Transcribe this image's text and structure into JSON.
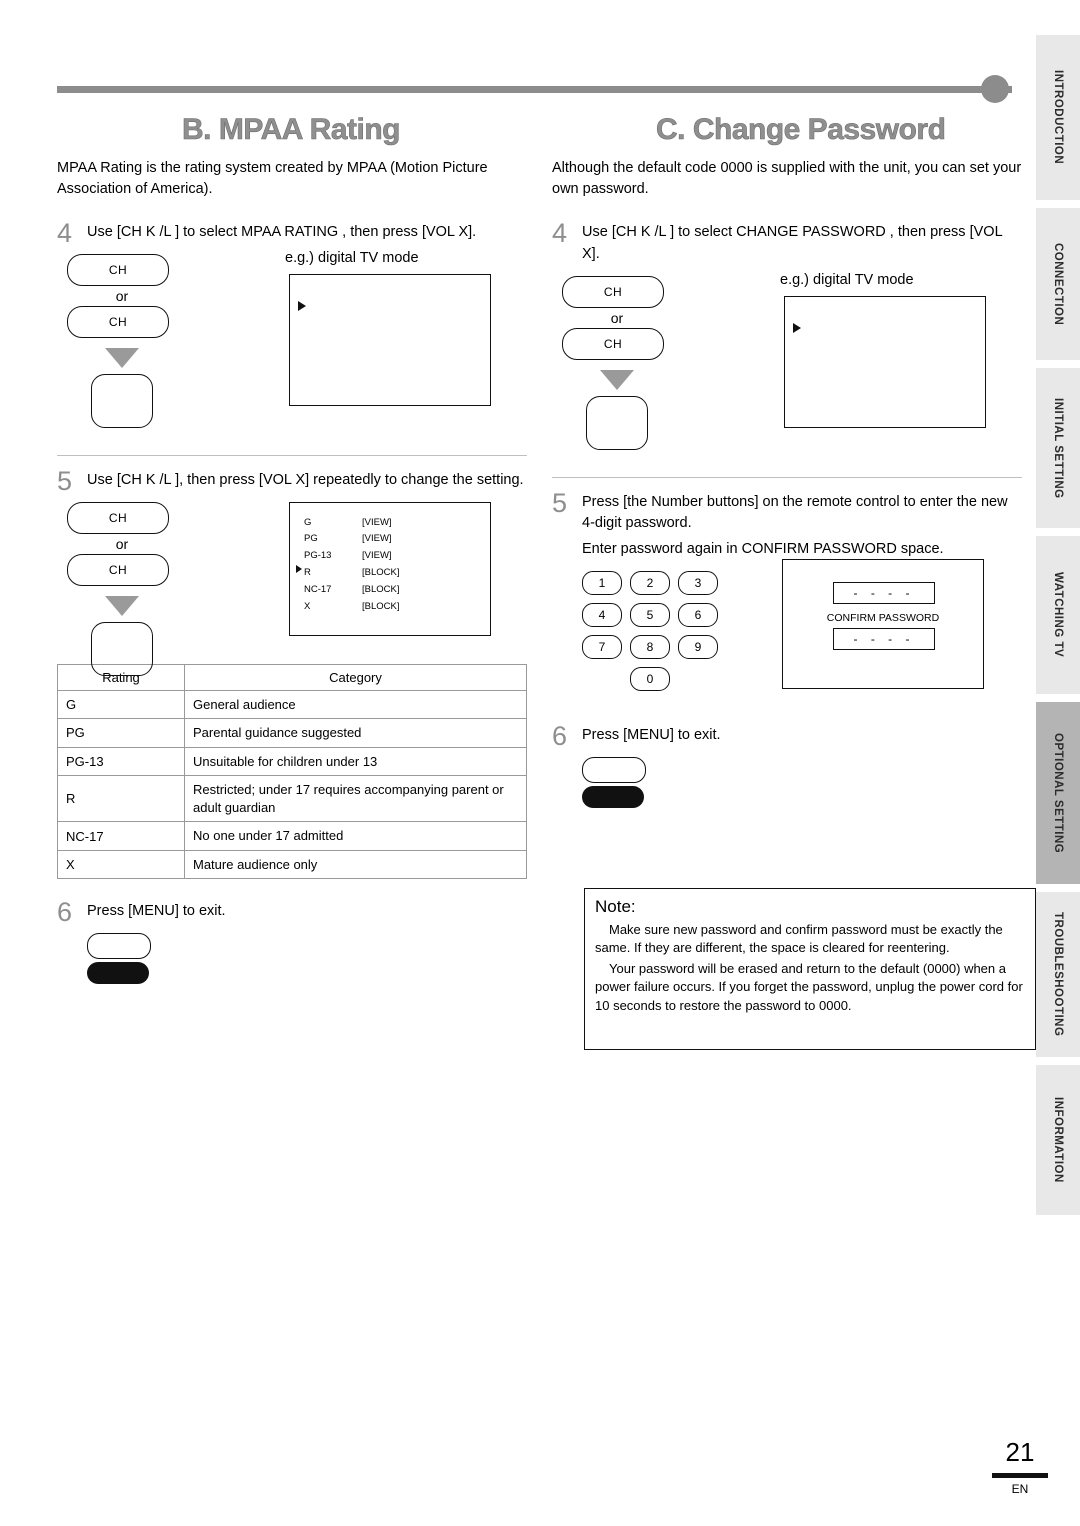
{
  "side_tabs": [
    {
      "label": "INTRODUCTION",
      "active": false
    },
    {
      "label": "CONNECTION",
      "active": false
    },
    {
      "label": "INITIAL SETTING",
      "active": false
    },
    {
      "label": "WATCHING TV",
      "active": false
    },
    {
      "label": "OPTIONAL SETTING",
      "active": true
    },
    {
      "label": "TROUBLESHOOTING",
      "active": false
    },
    {
      "label": "INFORMATION",
      "active": false
    }
  ],
  "left": {
    "heading": "B. MPAA Rating",
    "intro": "MPAA Rating is the rating system created by MPAA (Motion Picture Association of America).",
    "step4": {
      "num": "4",
      "text": "Use [CH K /L ] to select  MPAA RATING , then press [VOL X].",
      "eg": "e.g.) digital TV mode",
      "ch_up": "CH",
      "or": "or",
      "ch_down": "CH"
    },
    "step5": {
      "num": "5",
      "text": "Use [CH K /L ], then press [VOL X] repeatedly to change the setting.",
      "ch_up": "CH",
      "or": "or",
      "ch_down": "CH",
      "ratings": [
        {
          "code": "G",
          "state": "[VIEW]",
          "selected": false
        },
        {
          "code": "PG",
          "state": "[VIEW]",
          "selected": false
        },
        {
          "code": "PG-13",
          "state": "[VIEW]",
          "selected": false
        },
        {
          "code": "R",
          "state": "[BLOCK]",
          "selected": true
        },
        {
          "code": "NC-17",
          "state": "[BLOCK]",
          "selected": false
        },
        {
          "code": "X",
          "state": "[BLOCK]",
          "selected": false
        }
      ]
    },
    "table": {
      "headers": [
        "Rating",
        "Category"
      ],
      "rows": [
        [
          "G",
          "General audience"
        ],
        [
          "PG",
          "Parental guidance suggested"
        ],
        [
          "PG-13",
          "Unsuitable for children under 13"
        ],
        [
          "R",
          "Restricted; under 17 requires accompanying parent or adult guardian"
        ],
        [
          "NC-17",
          "No one under 17 admitted"
        ],
        [
          "X",
          "Mature audience only"
        ]
      ]
    },
    "step6": {
      "num": "6",
      "text": "Press [MENU] to exit."
    }
  },
  "right": {
    "heading": "C. Change Password",
    "intro": "Although the default code  0000  is supplied with the unit, you can set your own password.",
    "step4": {
      "num": "4",
      "text": "Use [CH K /L ] to select  CHANGE PASSWORD , then press [VOL X].",
      "eg": "e.g.) digital TV mode",
      "ch_up": "CH",
      "or": "or",
      "ch_down": "CH"
    },
    "step5": {
      "num": "5",
      "text": "Press [the Number buttons] on the remote control to enter the new 4-digit password.",
      "subtext": "Enter password again in  CONFIRM PASSWORD  space.",
      "numbers": [
        "1",
        "2",
        "3",
        "4",
        "5",
        "6",
        "7",
        "8",
        "9",
        "0"
      ],
      "confirm_label": "CONFIRM PASSWORD",
      "field_top": "- - - -",
      "field_bottom": "- - - -"
    },
    "step6": {
      "num": "6",
      "text": "Press [MENU] to exit."
    },
    "note": {
      "title": "Note:",
      "p1": "Make sure new password and confirm password must be exactly the same. If they are different, the space is cleared for reentering.",
      "p2": "Your password will be erased and return to the default (0000) when a power failure occurs. If you forget the password, unplug the power cord for 10 seconds to restore the password to 0000."
    }
  },
  "footer": {
    "page": "21",
    "lang": "EN"
  }
}
